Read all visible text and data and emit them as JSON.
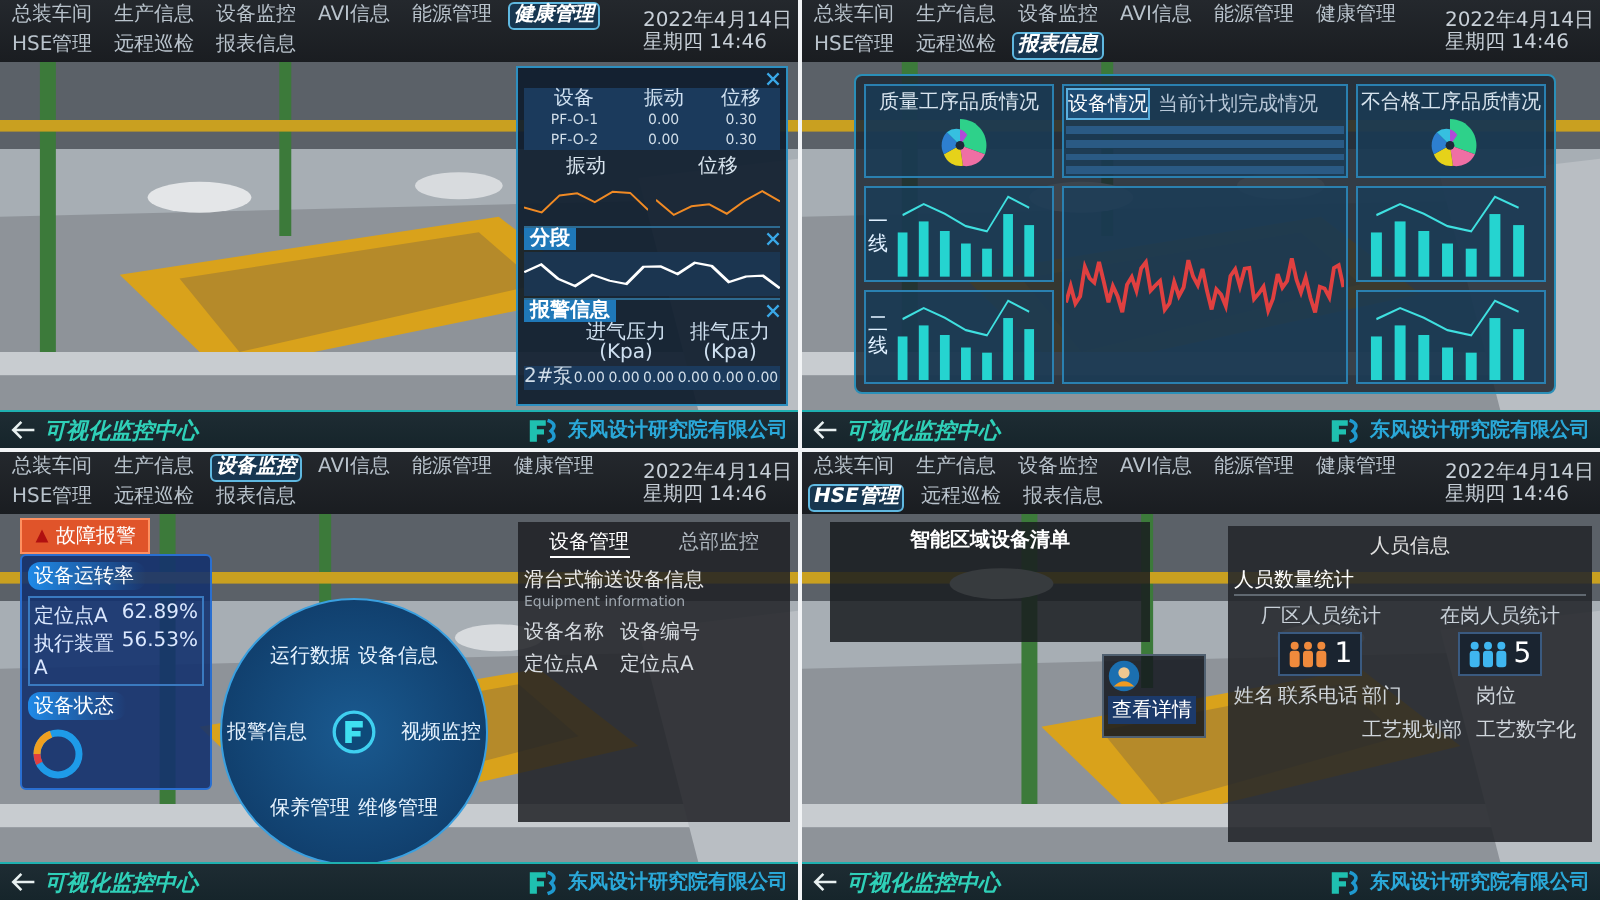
{
  "quadrants": [
    {
      "kind": "health",
      "nav": [
        {
          "label": "总装车间",
          "selected": false
        },
        {
          "label": "生产信息",
          "selected": false
        },
        {
          "label": "设备监控",
          "selected": false
        },
        {
          "label": "AVI信息",
          "selected": false
        },
        {
          "label": "能源管理",
          "selected": false
        },
        {
          "label": "健康管理",
          "selected": true
        },
        {
          "label": "HSE管理",
          "selected": false
        },
        {
          "label": "远程巡检",
          "selected": false
        },
        {
          "label": "报表信息",
          "selected": false
        }
      ],
      "date": "2022年4月14日",
      "time": "星期四 14:46",
      "footer_title": "可视化监控中心",
      "company": "东风设计研究院有限公司",
      "panel": {
        "columns": [
          "设备",
          "振动",
          "位移"
        ],
        "rows": [
          [
            "PF-O-1",
            "0.00",
            "0.30"
          ],
          [
            "PF-O-2",
            "0.00",
            "0.30"
          ]
        ],
        "charts": [
          "振动",
          "位移"
        ],
        "trend_title": "分段",
        "alarm_title": "报警信息",
        "alarm_columns": [
          "进气压力(Kpa)",
          "排气压力(Kpa)"
        ],
        "alarm_label": "2#泵",
        "alarm_values": [
          "0.00",
          "0.00",
          "0.00",
          "0.00",
          "0.00",
          "0.00"
        ]
      }
    },
    {
      "kind": "report",
      "nav": [
        {
          "label": "总装车间",
          "selected": false
        },
        {
          "label": "生产信息",
          "selected": false
        },
        {
          "label": "设备监控",
          "selected": false
        },
        {
          "label": "AVI信息",
          "selected": false
        },
        {
          "label": "能源管理",
          "selected": false
        },
        {
          "label": "健康管理",
          "selected": false
        },
        {
          "label": "HSE管理",
          "selected": false
        },
        {
          "label": "远程巡检",
          "selected": false
        },
        {
          "label": "报表信息",
          "selected": true
        }
      ],
      "date": "2022年4月14日",
      "time": "星期四 14:46",
      "footer_title": "可视化监控中心",
      "company": "东风设计研究院有限公司",
      "panel": {
        "pie_titles": [
          "质量工序品质情况",
          "不合格工序品质情况"
        ],
        "tabs": [
          {
            "label": "设备情况",
            "selected": true
          },
          {
            "label": "当前计划完成情况",
            "selected": false
          }
        ],
        "lines": [
          "一线",
          "二线"
        ]
      }
    },
    {
      "kind": "equipment",
      "nav": [
        {
          "label": "总装车间",
          "selected": false
        },
        {
          "label": "生产信息",
          "selected": false
        },
        {
          "label": "设备监控",
          "selected": true
        },
        {
          "label": "AVI信息",
          "selected": false
        },
        {
          "label": "能源管理",
          "selected": false
        },
        {
          "label": "健康管理",
          "selected": false
        },
        {
          "label": "HSE管理",
          "selected": false
        },
        {
          "label": "远程巡检",
          "selected": false
        },
        {
          "label": "报表信息",
          "selected": false
        }
      ],
      "date": "2022年4月14日",
      "time": "星期四 14:46",
      "footer_title": "可视化监控中心",
      "company": "东风设计研究院有限公司",
      "panel": {
        "alarm_button": "故障报警",
        "rate_title": "设备运转率",
        "rates": [
          {
            "label": "定位点A",
            "value": "62.89%"
          },
          {
            "label": "执行装置A",
            "value": "56.53%"
          }
        ],
        "status_title": "设备状态",
        "menu": [
          "运行数据",
          "设备信息",
          "视频监控",
          "维修管理",
          "保养管理",
          "报警信息"
        ],
        "tabs": [
          {
            "label": "设备管理",
            "selected": true
          },
          {
            "label": "总部监控",
            "selected": false
          }
        ],
        "info_title": "滑台式输送设备信息",
        "info_subtitle": "Equipment information",
        "fields": [
          {
            "label": "设备名称",
            "value": "定位点A"
          },
          {
            "label": "设备编号",
            "value": "定位点A"
          }
        ]
      }
    },
    {
      "kind": "hse",
      "nav": [
        {
          "label": "总装车间",
          "selected": false
        },
        {
          "label": "生产信息",
          "selected": false
        },
        {
          "label": "设备监控",
          "selected": false
        },
        {
          "label": "AVI信息",
          "selected": false
        },
        {
          "label": "能源管理",
          "selected": false
        },
        {
          "label": "健康管理",
          "selected": false
        },
        {
          "label": "HSE管理",
          "selected": true
        },
        {
          "label": "远程巡检",
          "selected": false
        },
        {
          "label": "报表信息",
          "selected": false
        }
      ],
      "date": "2022年4月14日",
      "time": "星期四 14:46",
      "footer_title": "可视化监控中心",
      "company": "东风设计研究院有限公司",
      "panel": {
        "list_title": "智能区域设备清单",
        "card_button": "查看详情",
        "info_title": "人员信息",
        "count_title": "人员数量统计",
        "counts": [
          {
            "label": "厂区人员统计",
            "value": "1",
            "color": "#f08a3c"
          },
          {
            "label": "在岗人员统计",
            "value": "5",
            "color": "#3fb6f0"
          }
        ],
        "columns": [
          "姓名",
          "联系电话",
          "部门",
          "岗位"
        ],
        "row": [
          "工艺规划部",
          "工艺数字化"
        ]
      }
    }
  ]
}
